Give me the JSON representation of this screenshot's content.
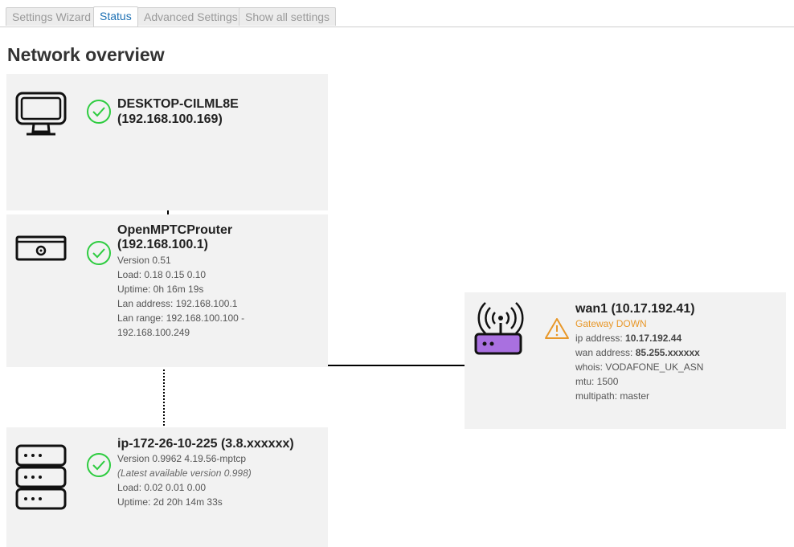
{
  "tabs": [
    {
      "label": "Settings Wizard"
    },
    {
      "label": "Status"
    },
    {
      "label": "Advanced Settings"
    },
    {
      "label": "Show all settings"
    }
  ],
  "page_title": "Network overview",
  "client": {
    "name": "DESKTOP-CILML8E",
    "ip": "(192.168.100.169)"
  },
  "router": {
    "name": "OpenMPTCProuter",
    "ip": "(192.168.100.1)",
    "version": "Version 0.51",
    "load": "Load: 0.18 0.15 0.10",
    "uptime": "Uptime: 0h 16m 19s",
    "lan_address": "Lan address: 192.168.100.1",
    "lan_range_1": "Lan range: 192.168.100.100 -",
    "lan_range_2": "192.168.100.249"
  },
  "server": {
    "title": "ip-172-26-10-225 (3.8.xxxxxx)",
    "version": "Version 0.9962 4.19.56-mptcp",
    "latest": "(Latest available version 0.998)",
    "load": "Load: 0.02 0.01 0.00",
    "uptime": "Uptime: 2d 20h 14m 33s"
  },
  "wan": {
    "title": "wan1 (10.17.192.41)",
    "status": "Gateway DOWN",
    "ip_label": "ip address: ",
    "ip_value": "10.17.192.44",
    "wan_label": "wan address: ",
    "wan_value": "85.255.xxxxxx",
    "whois": "whois: VODAFONE_UK_ASN",
    "mtu": "mtu: 1500",
    "multipath": "multipath: master"
  },
  "colors": {
    "ok_green": "#2ecc40",
    "warning_orange": "#e8982a",
    "modem_purple": "#a970e0",
    "active_tab": "#1b6fb3"
  },
  "icons": [
    "monitor-icon",
    "router-icon",
    "server-stack-icon",
    "wifi-modem-icon",
    "check-circle-icon",
    "warning-triangle-icon"
  ]
}
